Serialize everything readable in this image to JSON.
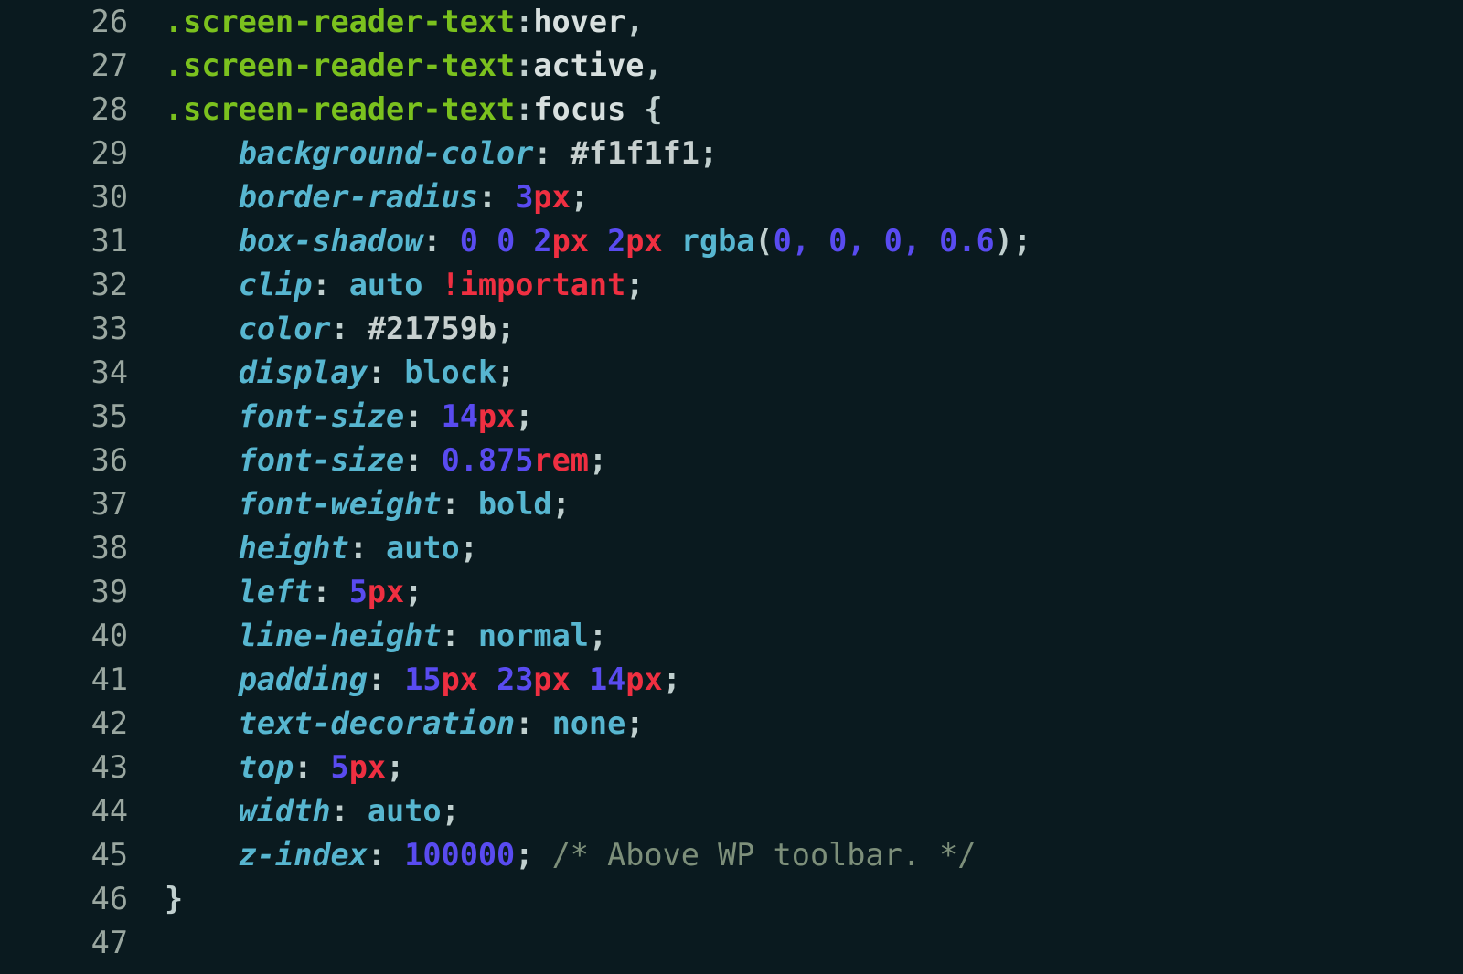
{
  "line_start": 26,
  "selectors": {
    "sel": ".screen-reader-text",
    "hover": "hover",
    "active": "active",
    "focus": "focus"
  },
  "props": {
    "bgcolor": "background-color",
    "bradius": "border-radius",
    "boxshadow": "box-shadow",
    "clip": "clip",
    "color": "color",
    "display": "display",
    "fontsize": "font-size",
    "fontweight": "font-weight",
    "height": "height",
    "left": "left",
    "lineheight": "line-height",
    "padding": "padding",
    "textdec": "text-decoration",
    "top": "top",
    "width": "width",
    "zindex": "z-index"
  },
  "vals": {
    "bgcolor_hex": "#f1f1f1",
    "bradius_n": "3",
    "bradius_u": "px",
    "shadow_a": "0",
    "shadow_b": "0",
    "shadow_c": "2",
    "shadow_cu": "px",
    "shadow_d": "2",
    "shadow_du": "px",
    "rgba_fn": "rgba",
    "rgba_args": "0, 0, 0, 0.6",
    "clip_v": "auto",
    "clip_imp": "!important",
    "color_hex": "#21759b",
    "display_v": "block",
    "fs1_n": "14",
    "fs1_u": "px",
    "fs2_n": "0.875",
    "fs2_u": "rem",
    "fw_v": "bold",
    "height_v": "auto",
    "left_n": "5",
    "left_u": "px",
    "lh_v": "normal",
    "pad_a": "15",
    "pad_au": "px",
    "pad_b": "23",
    "pad_bu": "px",
    "pad_c": "14",
    "pad_cu": "px",
    "td_v": "none",
    "top_n": "5",
    "top_u": "px",
    "width_v": "auto",
    "z_n": "100000",
    "comment": "/* Above WP toolbar. */"
  },
  "p": {
    "colon": ":",
    "semi": ";",
    "comma": ",",
    "obr": "{",
    "cbr": "}",
    "op": "(",
    "cp": ")"
  }
}
